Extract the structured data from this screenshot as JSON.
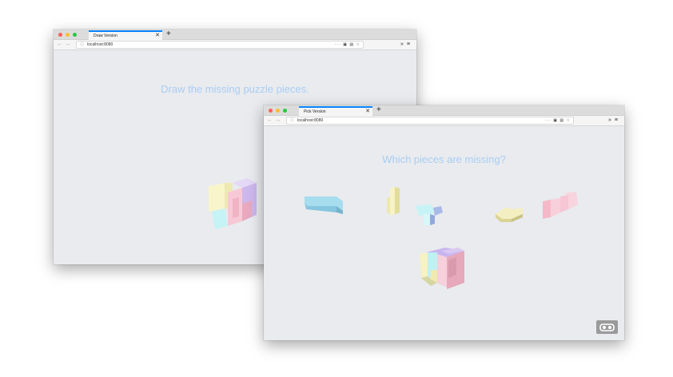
{
  "draw_window": {
    "tab_title": "Draw Version",
    "tab_close": "✕",
    "new_tab": "+",
    "url": "localhost:8080",
    "heading": "Draw the missing puzzle pieces."
  },
  "pick_window": {
    "tab_title": "Pick Version",
    "tab_close": "✕",
    "new_tab": "+",
    "url": "localhost:8080",
    "heading": "Which pieces are missing?"
  },
  "toolbar": {
    "back": "←",
    "forward": "→",
    "info": "ⓘ",
    "page_actions": "··· ▣ ▤ ☆",
    "overflow": "»",
    "menu": "≡"
  },
  "colors": {
    "heading": "#a9cdf5",
    "background": "#e9ebee",
    "piece_blue": "#a8dcef",
    "piece_yellow": "#f7f3c4",
    "piece_pink": "#f6c6d4",
    "piece_purple": "#d9c8f1",
    "piece_cyan": "#bff0f2"
  }
}
